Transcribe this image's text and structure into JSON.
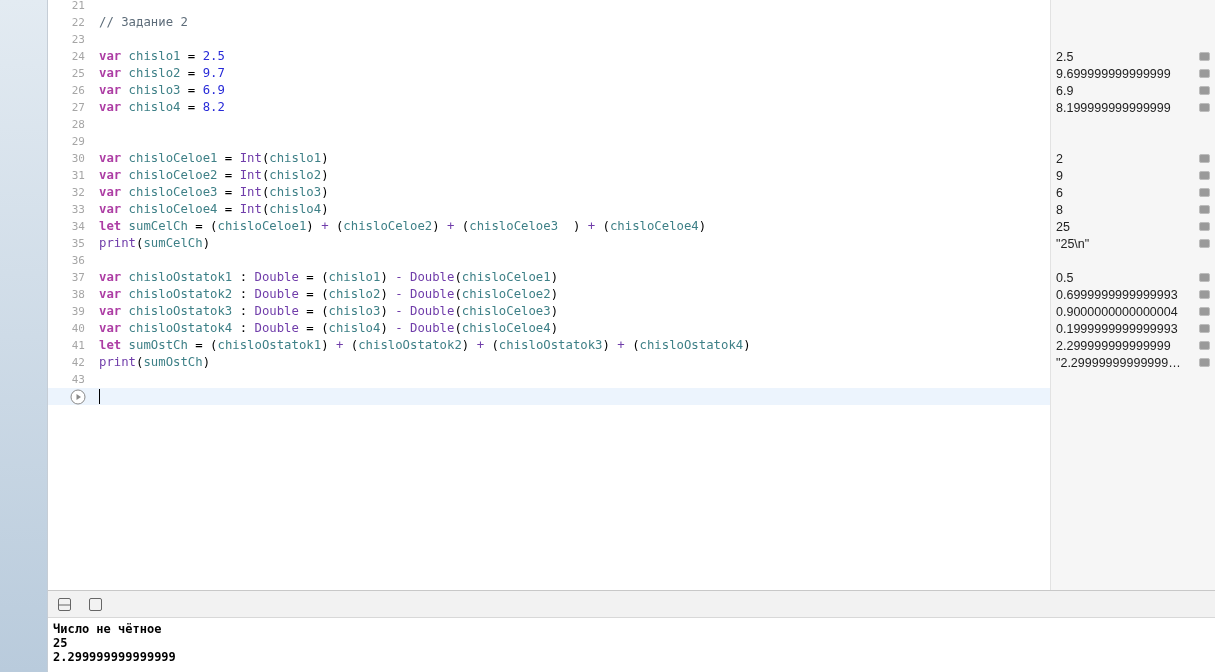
{
  "editor": {
    "lines": [
      {
        "number": "21"
      },
      {
        "number": "22",
        "tokens": [
          {
            "kind": "comment",
            "text": "// Задание 2"
          }
        ]
      },
      {
        "number": "23"
      },
      {
        "number": "24",
        "result": "2.5",
        "tokens": [
          {
            "kind": "keyword",
            "text": "var"
          },
          {
            "kind": "ident",
            "text": " chislo1"
          },
          {
            "kind": "plain",
            "text": " = "
          },
          {
            "kind": "number",
            "text": "2.5"
          }
        ]
      },
      {
        "number": "25",
        "result": "9.699999999999999",
        "tokens": [
          {
            "kind": "keyword",
            "text": "var"
          },
          {
            "kind": "ident",
            "text": " chislo2"
          },
          {
            "kind": "plain",
            "text": " = "
          },
          {
            "kind": "number",
            "text": "9.7"
          }
        ]
      },
      {
        "number": "26",
        "result": "6.9",
        "tokens": [
          {
            "kind": "keyword",
            "text": "var"
          },
          {
            "kind": "ident",
            "text": " chislo3"
          },
          {
            "kind": "plain",
            "text": " = "
          },
          {
            "kind": "number",
            "text": "6.9"
          }
        ]
      },
      {
        "number": "27",
        "result": "8.199999999999999",
        "tokens": [
          {
            "kind": "keyword",
            "text": "var"
          },
          {
            "kind": "ident",
            "text": " chislo4"
          },
          {
            "kind": "plain",
            "text": " = "
          },
          {
            "kind": "number",
            "text": "8.2"
          }
        ]
      },
      {
        "number": "28"
      },
      {
        "number": "29"
      },
      {
        "number": "30",
        "result": "2",
        "tokens": [
          {
            "kind": "keyword",
            "text": "var"
          },
          {
            "kind": "ident",
            "text": " chisloCeloe1"
          },
          {
            "kind": "plain",
            "text": " = "
          },
          {
            "kind": "type",
            "text": "Int"
          },
          {
            "kind": "plain",
            "text": "("
          },
          {
            "kind": "ident",
            "text": "chislo1"
          },
          {
            "kind": "plain",
            "text": ")"
          }
        ]
      },
      {
        "number": "31",
        "result": "9",
        "tokens": [
          {
            "kind": "keyword",
            "text": "var"
          },
          {
            "kind": "ident",
            "text": " chisloCeloe2"
          },
          {
            "kind": "plain",
            "text": " = "
          },
          {
            "kind": "type",
            "text": "Int"
          },
          {
            "kind": "plain",
            "text": "("
          },
          {
            "kind": "ident",
            "text": "chislo2"
          },
          {
            "kind": "plain",
            "text": ")"
          }
        ]
      },
      {
        "number": "32",
        "result": "6",
        "tokens": [
          {
            "kind": "keyword",
            "text": "var"
          },
          {
            "kind": "ident",
            "text": " chisloCeloe3"
          },
          {
            "kind": "plain",
            "text": " = "
          },
          {
            "kind": "type",
            "text": "Int"
          },
          {
            "kind": "plain",
            "text": "("
          },
          {
            "kind": "ident",
            "text": "chislo3"
          },
          {
            "kind": "plain",
            "text": ")"
          }
        ]
      },
      {
        "number": "33",
        "result": "8",
        "tokens": [
          {
            "kind": "keyword",
            "text": "var"
          },
          {
            "kind": "ident",
            "text": " chisloCeloe4"
          },
          {
            "kind": "plain",
            "text": " = "
          },
          {
            "kind": "type",
            "text": "Int"
          },
          {
            "kind": "plain",
            "text": "("
          },
          {
            "kind": "ident",
            "text": "chislo4"
          },
          {
            "kind": "plain",
            "text": ")"
          }
        ]
      },
      {
        "number": "34",
        "result": "25",
        "tokens": [
          {
            "kind": "keyword",
            "text": "let"
          },
          {
            "kind": "ident",
            "text": " sumCelCh"
          },
          {
            "kind": "plain",
            "text": " = ("
          },
          {
            "kind": "ident",
            "text": "chisloCeloe1"
          },
          {
            "kind": "plain",
            "text": ") "
          },
          {
            "kind": "op",
            "text": "+"
          },
          {
            "kind": "plain",
            "text": " ("
          },
          {
            "kind": "ident",
            "text": "chisloCeloe2"
          },
          {
            "kind": "plain",
            "text": ") "
          },
          {
            "kind": "op",
            "text": "+"
          },
          {
            "kind": "plain",
            "text": " ("
          },
          {
            "kind": "ident",
            "text": "chisloCeloe3"
          },
          {
            "kind": "plain",
            "text": "  ) "
          },
          {
            "kind": "op",
            "text": "+"
          },
          {
            "kind": "plain",
            "text": " ("
          },
          {
            "kind": "ident",
            "text": "chisloCeloe4"
          },
          {
            "kind": "plain",
            "text": ")"
          }
        ]
      },
      {
        "number": "35",
        "result": "\"25\\n\"",
        "tokens": [
          {
            "kind": "type",
            "text": "print"
          },
          {
            "kind": "plain",
            "text": "("
          },
          {
            "kind": "ident",
            "text": "sumCelCh"
          },
          {
            "kind": "plain",
            "text": ")"
          }
        ]
      },
      {
        "number": "36"
      },
      {
        "number": "37",
        "result": "0.5",
        "tokens": [
          {
            "kind": "keyword",
            "text": "var"
          },
          {
            "kind": "ident",
            "text": " chisloOstatok1"
          },
          {
            "kind": "plain",
            "text": " : "
          },
          {
            "kind": "type",
            "text": "Double"
          },
          {
            "kind": "plain",
            "text": " = ("
          },
          {
            "kind": "ident",
            "text": "chislo1"
          },
          {
            "kind": "plain",
            "text": ") "
          },
          {
            "kind": "op",
            "text": "-"
          },
          {
            "kind": "type",
            "text": " Double"
          },
          {
            "kind": "plain",
            "text": "("
          },
          {
            "kind": "ident",
            "text": "chisloCeloe1"
          },
          {
            "kind": "plain",
            "text": ")"
          }
        ]
      },
      {
        "number": "38",
        "result": "0.6999999999999993",
        "tokens": [
          {
            "kind": "keyword",
            "text": "var"
          },
          {
            "kind": "ident",
            "text": " chisloOstatok2"
          },
          {
            "kind": "plain",
            "text": " : "
          },
          {
            "kind": "type",
            "text": "Double"
          },
          {
            "kind": "plain",
            "text": " = ("
          },
          {
            "kind": "ident",
            "text": "chislo2"
          },
          {
            "kind": "plain",
            "text": ") "
          },
          {
            "kind": "op",
            "text": "-"
          },
          {
            "kind": "type",
            "text": " Double"
          },
          {
            "kind": "plain",
            "text": "("
          },
          {
            "kind": "ident",
            "text": "chisloCeloe2"
          },
          {
            "kind": "plain",
            "text": ")"
          }
        ]
      },
      {
        "number": "39",
        "result": "0.9000000000000004",
        "tokens": [
          {
            "kind": "keyword",
            "text": "var"
          },
          {
            "kind": "ident",
            "text": " chisloOstatok3"
          },
          {
            "kind": "plain",
            "text": " : "
          },
          {
            "kind": "type",
            "text": "Double"
          },
          {
            "kind": "plain",
            "text": " = ("
          },
          {
            "kind": "ident",
            "text": "chislo3"
          },
          {
            "kind": "plain",
            "text": ") "
          },
          {
            "kind": "op",
            "text": "-"
          },
          {
            "kind": "type",
            "text": " Double"
          },
          {
            "kind": "plain",
            "text": "("
          },
          {
            "kind": "ident",
            "text": "chisloCeloe3"
          },
          {
            "kind": "plain",
            "text": ")"
          }
        ]
      },
      {
        "number": "40",
        "result": "0.1999999999999993",
        "tokens": [
          {
            "kind": "keyword",
            "text": "var"
          },
          {
            "kind": "ident",
            "text": " chisloOstatok4"
          },
          {
            "kind": "plain",
            "text": " : "
          },
          {
            "kind": "type",
            "text": "Double"
          },
          {
            "kind": "plain",
            "text": " = ("
          },
          {
            "kind": "ident",
            "text": "chislo4"
          },
          {
            "kind": "plain",
            "text": ") "
          },
          {
            "kind": "op",
            "text": "-"
          },
          {
            "kind": "type",
            "text": " Double"
          },
          {
            "kind": "plain",
            "text": "("
          },
          {
            "kind": "ident",
            "text": "chisloCeloe4"
          },
          {
            "kind": "plain",
            "text": ")"
          }
        ]
      },
      {
        "number": "41",
        "result": "2.299999999999999",
        "tokens": [
          {
            "kind": "keyword",
            "text": "let"
          },
          {
            "kind": "ident",
            "text": " sumOstCh"
          },
          {
            "kind": "plain",
            "text": " = ("
          },
          {
            "kind": "ident",
            "text": "chisloOstatok1"
          },
          {
            "kind": "plain",
            "text": ") "
          },
          {
            "kind": "op",
            "text": "+"
          },
          {
            "kind": "plain",
            "text": " ("
          },
          {
            "kind": "ident",
            "text": "chisloOstatok2"
          },
          {
            "kind": "plain",
            "text": ") "
          },
          {
            "kind": "op",
            "text": "+"
          },
          {
            "kind": "plain",
            "text": " ("
          },
          {
            "kind": "ident",
            "text": "chisloOstatok3"
          },
          {
            "kind": "plain",
            "text": ") "
          },
          {
            "kind": "op",
            "text": "+"
          },
          {
            "kind": "plain",
            "text": " ("
          },
          {
            "kind": "ident",
            "text": "chisloOstatok4"
          },
          {
            "kind": "plain",
            "text": ")"
          }
        ]
      },
      {
        "number": "42",
        "result": "\"2.29999999999999…",
        "tokens": [
          {
            "kind": "type",
            "text": "print"
          },
          {
            "kind": "plain",
            "text": "("
          },
          {
            "kind": "ident",
            "text": "sumOstCh"
          },
          {
            "kind": "plain",
            "text": ")"
          }
        ]
      },
      {
        "number": "43"
      },
      {
        "kind": "run"
      }
    ]
  },
  "console": {
    "lines": [
      "Число не чётное",
      "25",
      "2.299999999999999"
    ]
  }
}
